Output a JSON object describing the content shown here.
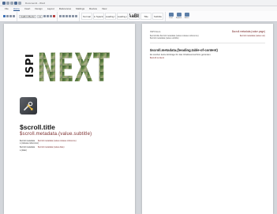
{
  "window": {
    "title": "Document1 - Word"
  },
  "menu": {
    "tabs": [
      "File",
      "Home",
      "Insert",
      "Design",
      "Layout",
      "References",
      "Mailings",
      "Review",
      "View"
    ]
  },
  "ribbon": {
    "font_name": "Calibri (Body)",
    "font_size": "11",
    "styles": [
      "Normal",
      "No Spacing",
      "Heading 1",
      "Heading 2",
      "AaBb",
      "Title",
      "Subtitle"
    ],
    "buttons": [
      "Find",
      "Replace",
      "Select"
    ]
  },
  "cover": {
    "logo_isp": "ISPI",
    "logo_next": "NEXT",
    "title": "$scroll.title",
    "subtitle": "$scroll.metadata.(value.subtitle)",
    "meta": [
      {
        "key": "$scroll.metadata",
        "value": "$scroll.metadata.(value.release.reference)"
      },
      {
        "key": "s.(release.reference)",
        "value": ""
      },
      {
        "key": "$scroll.metadata",
        "value": "$scroll.metadata.(value.date)"
      },
      {
        "key": "s.(date)",
        "value": ""
      }
    ]
  },
  "content_page": {
    "header_left": "ISPI Docs",
    "header_right": "$scroll.metadata.(value.page)",
    "lines": [
      {
        "left": "$scroll.title $scroll.metadata.(value.release.reference)",
        "right": "$scroll.metadata.(value.ver)"
      },
      {
        "left": "$scroll.metadata.(value.subtitle)",
        "right": ""
      }
    ],
    "toc_heading": "$scroll.metadata.(heading.table-of-content)",
    "toc_text": "Es wurden keine Einträge für das Inhaltsverzeichnis gefunden.",
    "toc_link": "$scroll.content"
  }
}
